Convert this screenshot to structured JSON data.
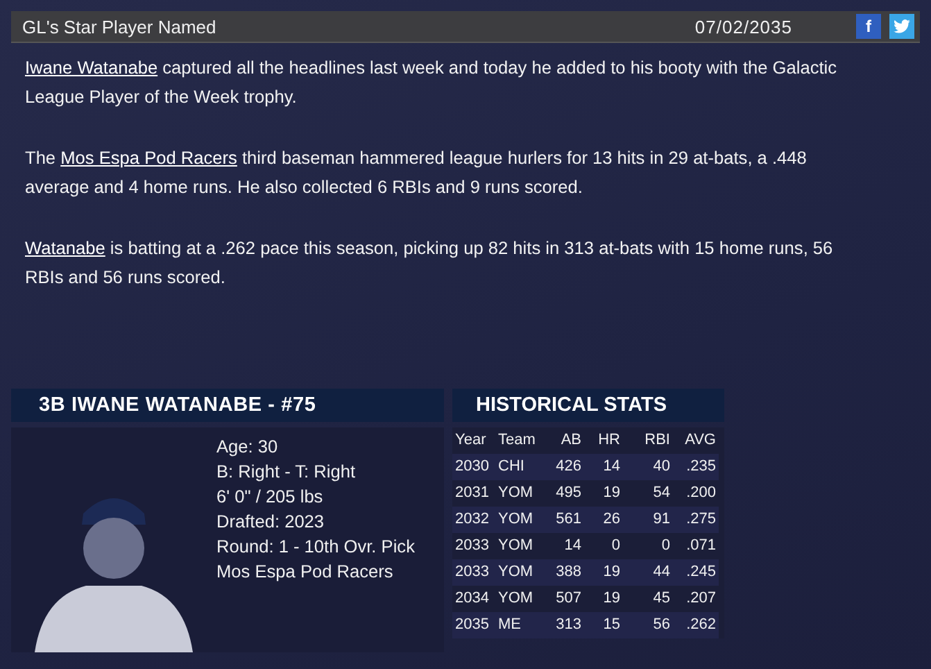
{
  "header": {
    "title": "GL's Star Player Named",
    "date": "07/02/2035",
    "share_buttons": [
      {
        "kind": "facebook",
        "label": "f"
      },
      {
        "kind": "twitter"
      }
    ]
  },
  "article": {
    "paragraphs": [
      [
        {
          "text": "Iwane Watanabe",
          "link": true
        },
        {
          "text": " captured all the headlines last week and today he added to his booty with the Galactic League Player of the Week trophy.",
          "link": false
        }
      ],
      [
        {
          "text": "The ",
          "link": false
        },
        {
          "text": "Mos Espa Pod Racers",
          "link": true
        },
        {
          "text": " third baseman hammered league hurlers for 13 hits in 29 at-bats, a .448 average and 4 home runs. He also collected 6 RBIs and 9 runs scored.",
          "link": false
        }
      ],
      [
        {
          "text": "Watanabe",
          "link": true
        },
        {
          "text": " is batting at a .262 pace this season, picking up 82 hits in 313 at-bats with 15 home runs, 56 RBIs and 56 runs scored.",
          "link": false
        }
      ]
    ]
  },
  "player_card": {
    "title": "3B IWANE WATANABE - #75",
    "details": [
      "Age: 30",
      "B: Right - T: Right",
      "6' 0\" / 205 lbs",
      "Drafted: 2023",
      "Round: 1 - 10th Ovr. Pick",
      "Mos Espa Pod Racers"
    ]
  },
  "historical_stats": {
    "title": "HISTORICAL STATS",
    "columns": [
      "Year",
      "Team",
      "AB",
      "HR",
      "RBI",
      "AVG"
    ],
    "rows": [
      [
        "2030",
        "CHI",
        "426",
        "14",
        "40",
        ".235"
      ],
      [
        "2031",
        "YOM",
        "495",
        "19",
        "54",
        ".200"
      ],
      [
        "2032",
        "YOM",
        "561",
        "26",
        "91",
        ".275"
      ],
      [
        "2033",
        "YOM",
        "14",
        "0",
        "0",
        ".071"
      ],
      [
        "2033",
        "YOM",
        "388",
        "19",
        "44",
        ".245"
      ],
      [
        "2034",
        "YOM",
        "507",
        "19",
        "45",
        ".207"
      ],
      [
        "2035",
        "ME",
        "313",
        "15",
        "56",
        ".262"
      ]
    ]
  }
}
